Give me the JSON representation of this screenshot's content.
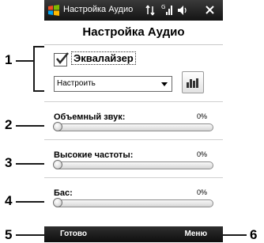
{
  "callouts": [
    "1",
    "2",
    "3",
    "4",
    "5",
    "6"
  ],
  "status_bar": {
    "title": "Настройка Аудио",
    "icons": [
      "windows-logo",
      "connectivity-icon",
      "signal-icon",
      "volume-icon",
      "close-icon"
    ]
  },
  "page": {
    "title": "Настройка Аудио"
  },
  "equalizer": {
    "checked": true,
    "label": "Эквалайзер",
    "preset_value": "Настроить",
    "settings_button_icon": "equalizer-icon"
  },
  "sliders": [
    {
      "label": "Объемный звук:",
      "value_text": "0%",
      "value": 0
    },
    {
      "label": "Высокие частоты:",
      "value_text": "0%",
      "value": 0
    },
    {
      "label": "Бас:",
      "value_text": "0%",
      "value": 0
    }
  ],
  "softkeys": {
    "left": "Готово",
    "right": "Меню"
  },
  "colors": {
    "bar_bg": "#1a1a1a",
    "bar_text": "#ffffff"
  }
}
